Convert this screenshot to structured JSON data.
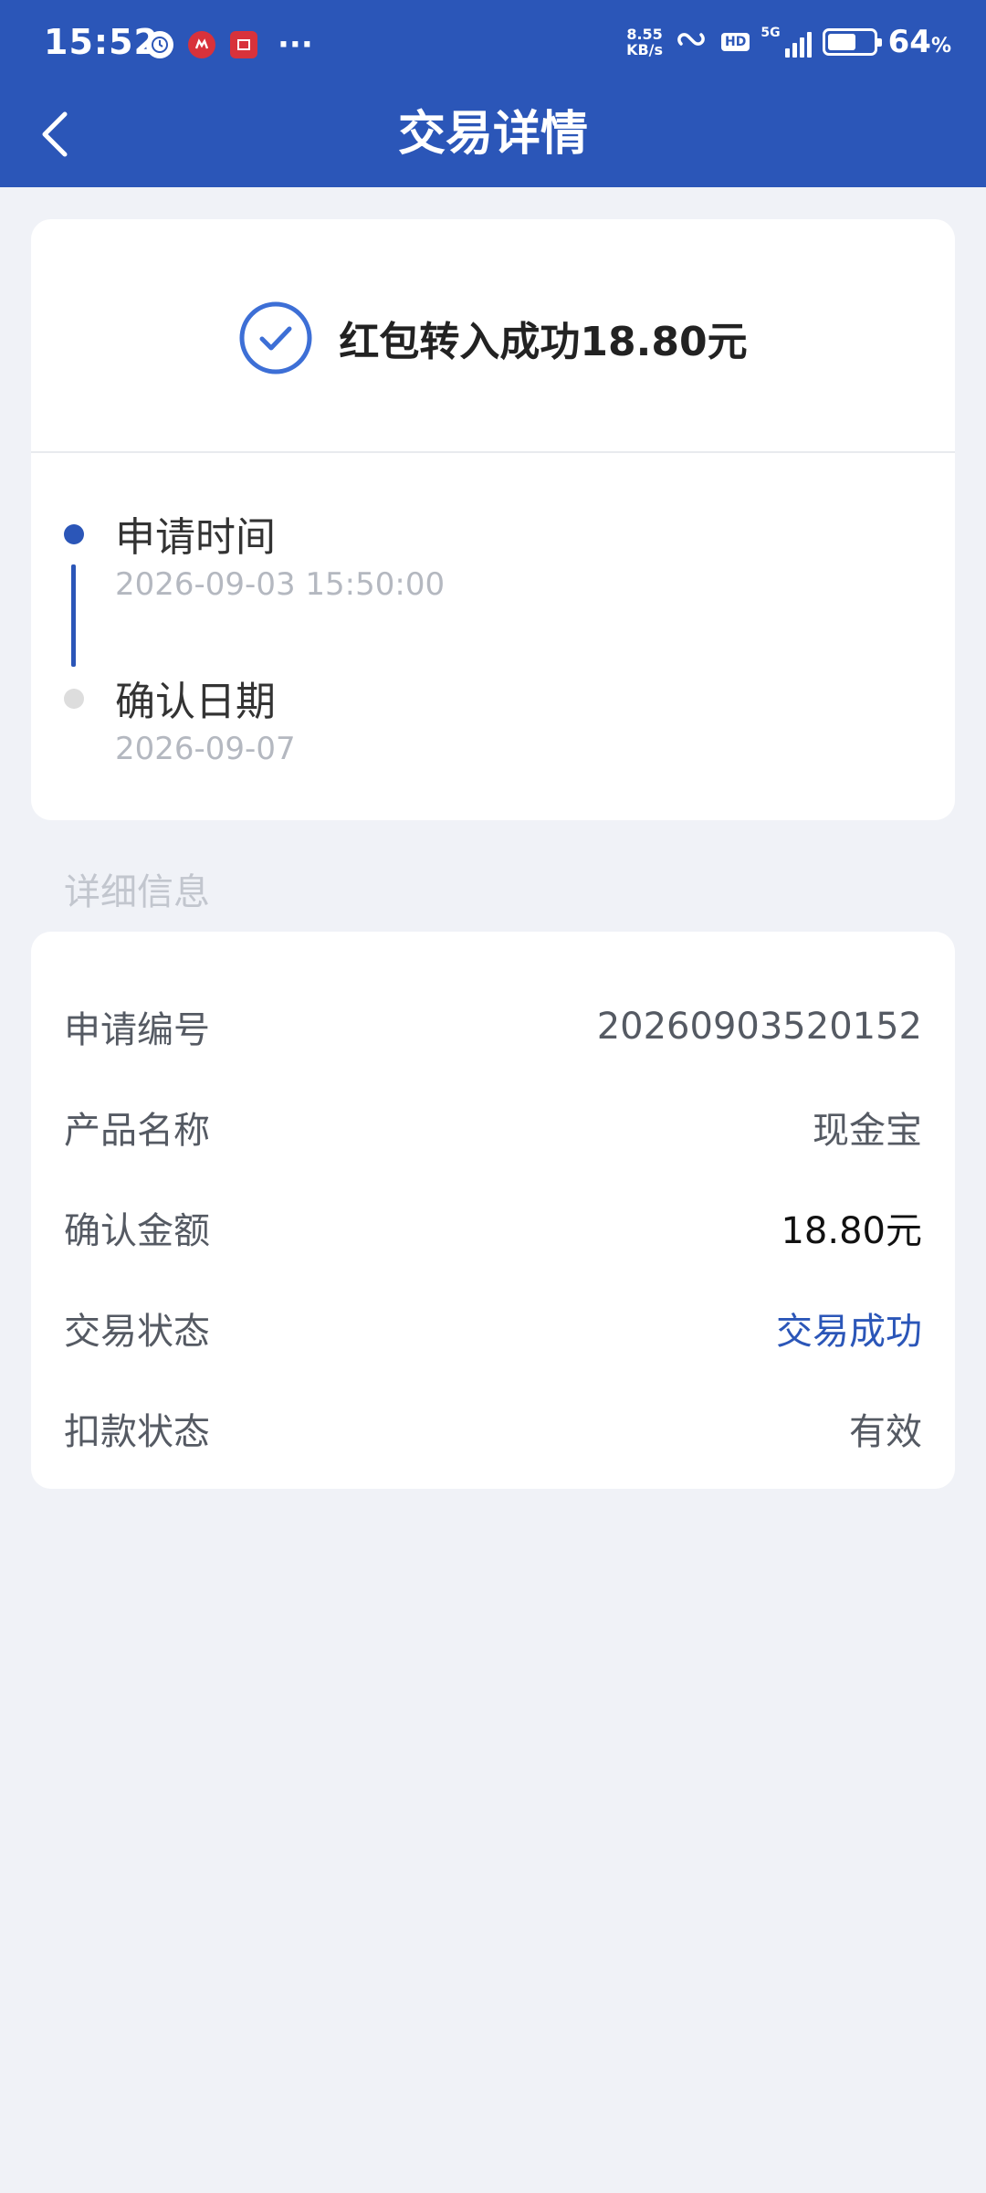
{
  "status_bar": {
    "time": "15:52",
    "net_speed_value": "8.55",
    "net_speed_unit": "KB/s",
    "hd_label": "HD",
    "signal_label": "5G",
    "battery_percent": "64",
    "battery_unit": "%",
    "battery_level": 0.64,
    "more_label": "···"
  },
  "nav": {
    "title": "交易详情"
  },
  "result": {
    "text": "红包转入成功18.80元"
  },
  "timeline": [
    {
      "title": "申请时间",
      "time": "2026-09-03 15:50:00"
    },
    {
      "title": "确认日期",
      "time": "2026-09-07"
    }
  ],
  "section_label": "详细信息",
  "details": [
    {
      "label": "申请编号",
      "value": "20260903520152"
    },
    {
      "label": "产品名称",
      "value": "现金宝"
    },
    {
      "label": "确认金额",
      "value": "18.80元"
    },
    {
      "label": "交易状态",
      "value": "交易成功"
    },
    {
      "label": "扣款状态",
      "value": "有效"
    }
  ],
  "colors": {
    "primary": "#2b56b8",
    "background": "#f0f2f7",
    "card": "#ffffff"
  }
}
